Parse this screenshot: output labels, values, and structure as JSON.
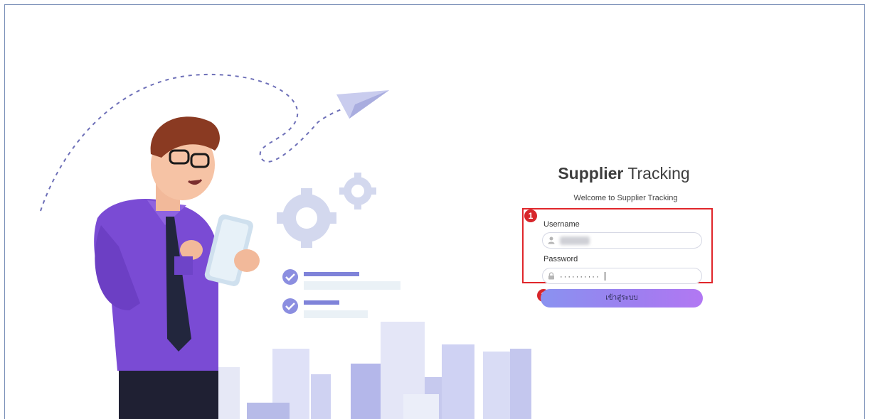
{
  "app": {
    "title_bold": "Supplier",
    "title_light": "Tracking",
    "welcome": "Welcome to Supplier Tracking"
  },
  "form": {
    "username_label": "Username",
    "username_value": "",
    "password_label": "Password",
    "password_value": "··········",
    "login_button": "เข้าสู่ระบบ"
  },
  "annotations": {
    "step1": "1",
    "step2": "2",
    "highlight_color": "#e0262b"
  },
  "icons": {
    "username": "user-icon",
    "password": "lock-icon"
  }
}
